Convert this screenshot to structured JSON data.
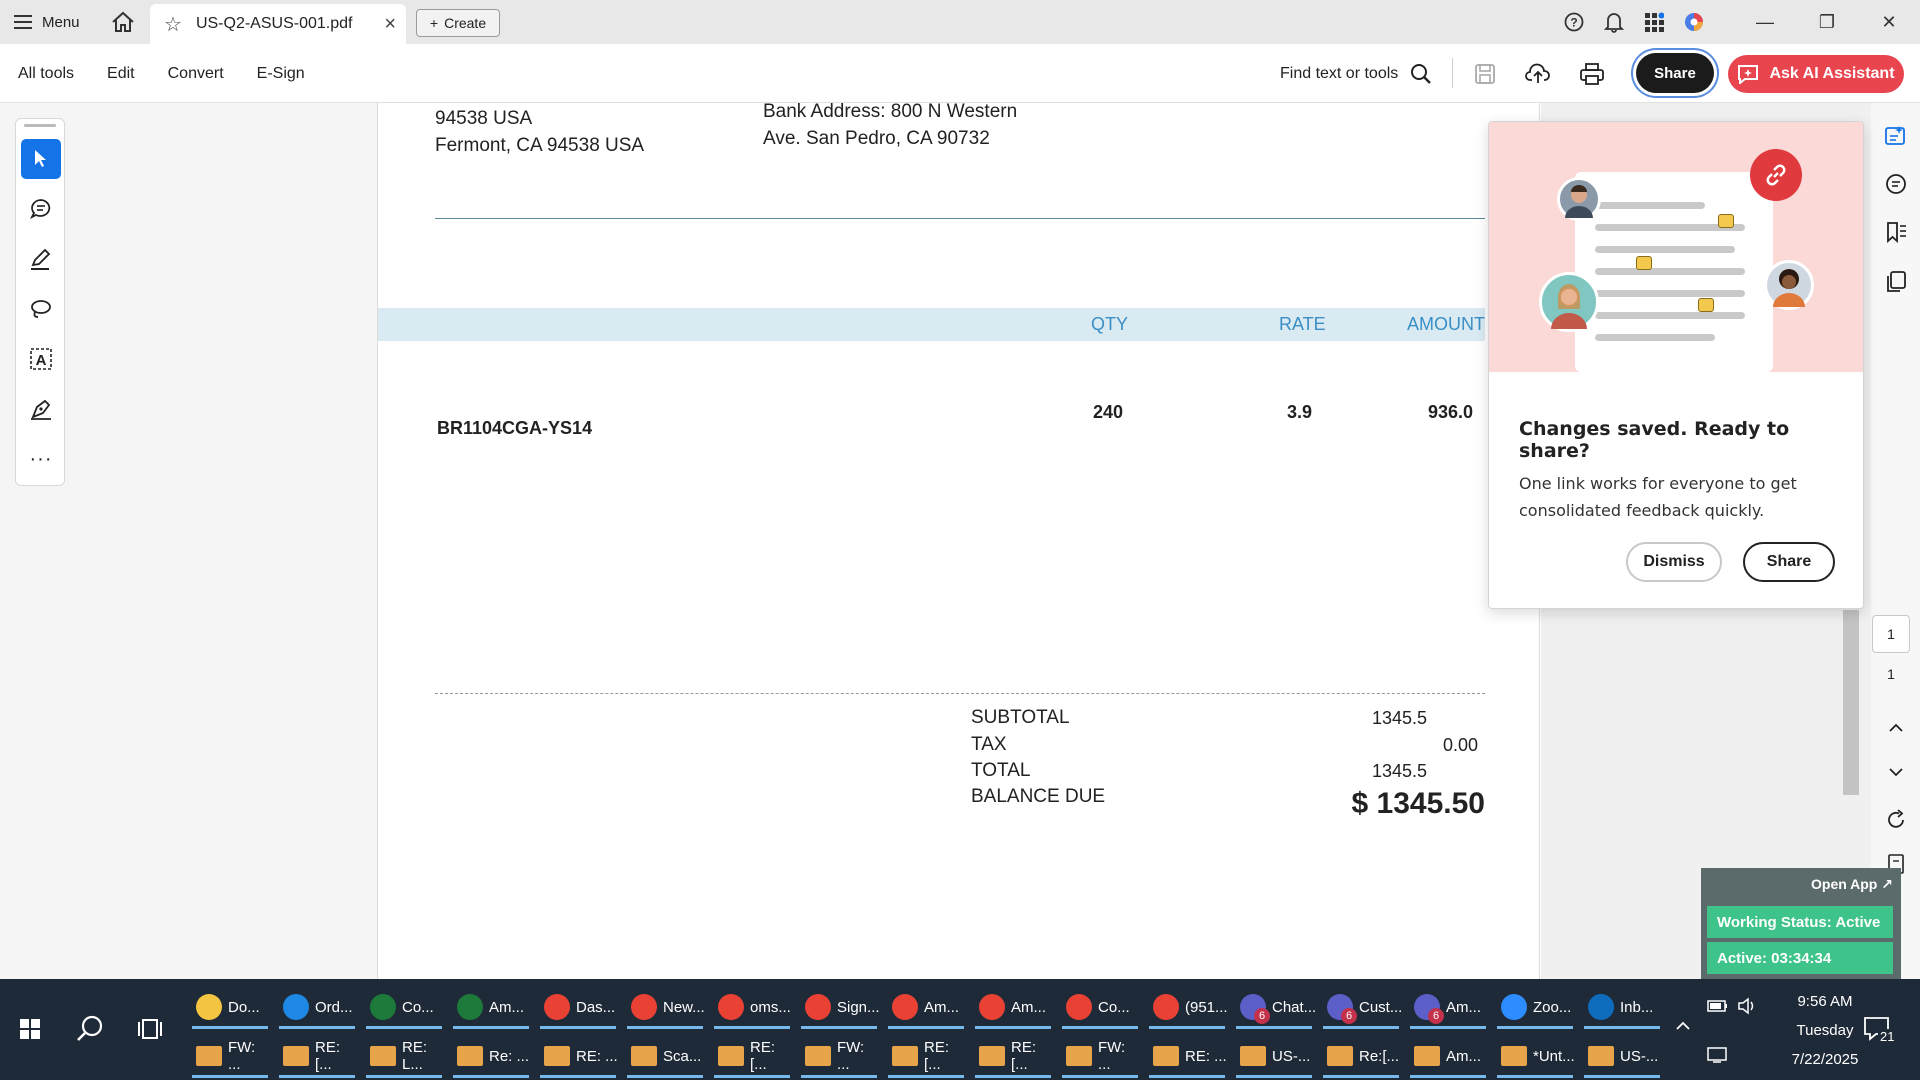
{
  "titlebar": {
    "menu_label": "Menu",
    "tab_title": "US-Q2-ASUS-001.pdf",
    "create_label": "Create"
  },
  "toolbar": {
    "menu": [
      "All tools",
      "Edit",
      "Convert",
      "E-Sign"
    ],
    "find_label": "Find text or tools",
    "share_label": "Share",
    "ask_ai_label": "Ask AI Assistant"
  },
  "document": {
    "addr_left_1": "94538 USA",
    "addr_left_2": "Fermont, CA  94538 USA",
    "bank_1": "Bank Address: 800 N Western",
    "bank_2": "Ave. San Pedro, CA 90732",
    "headers": {
      "qty": "QTY",
      "rate": "RATE",
      "amount": "AMOUNT"
    },
    "item": {
      "name": "BR1104CGA-YS14",
      "qty": "240",
      "rate": "3.9",
      "amount": "936.0"
    },
    "summary": {
      "subtotal_label": "SUBTOTAL",
      "subtotal": "1345.5",
      "tax_label": "TAX",
      "tax": "0.00",
      "total_label": "TOTAL",
      "total": "1345.5",
      "balance_label": "BALANCE DUE",
      "balance": "$  1345.50"
    }
  },
  "popup": {
    "title": "Changes saved. Ready to share?",
    "body": "One link works for everyone to get consolidated feedback quickly.",
    "dismiss": "Dismiss",
    "share": "Share"
  },
  "pager": {
    "current": "1",
    "total": "1"
  },
  "status_widget": {
    "open_app": "Open App ↗",
    "working_status": "Working Status: Active",
    "active_time": "Active: 03:34:34"
  },
  "taskbar": {
    "row1": [
      {
        "label": "Do...",
        "color": "#f4c542"
      },
      {
        "label": "Ord...",
        "color": "#1e88e5"
      },
      {
        "label": "Co...",
        "color": "#1d7a3a"
      },
      {
        "label": "Am...",
        "color": "#1d7a3a"
      },
      {
        "label": "Das...",
        "color": "#e94235"
      },
      {
        "label": "New...",
        "color": "#e94235"
      },
      {
        "label": "oms...",
        "color": "#e94235"
      },
      {
        "label": "Sign...",
        "color": "#e94235"
      },
      {
        "label": "Am...",
        "color": "#e94235"
      },
      {
        "label": "Am...",
        "color": "#e94235"
      },
      {
        "label": "Co...",
        "color": "#e94235"
      },
      {
        "label": "(951...",
        "color": "#e94235"
      },
      {
        "label": "Chat...",
        "color": "#5b5fc7",
        "badge": "6"
      },
      {
        "label": "Cust...",
        "color": "#5b5fc7",
        "badge": "6"
      },
      {
        "label": "Am...",
        "color": "#5b5fc7",
        "badge": "6"
      },
      {
        "label": "Zoo...",
        "color": "#2d8cff"
      },
      {
        "label": "Inb...",
        "color": "#0f6cbd"
      }
    ],
    "row2": [
      {
        "label": "FW: ..."
      },
      {
        "label": "RE: [..."
      },
      {
        "label": "RE: L..."
      },
      {
        "label": "Re: ..."
      },
      {
        "label": "RE: ..."
      },
      {
        "label": "Sca..."
      },
      {
        "label": "RE: [..."
      },
      {
        "label": "FW: ..."
      },
      {
        "label": "RE: [..."
      },
      {
        "label": "RE: [..."
      },
      {
        "label": "FW: ..."
      },
      {
        "label": "RE: ..."
      },
      {
        "label": "US-..."
      },
      {
        "label": "Re:[..."
      },
      {
        "label": "Am..."
      },
      {
        "label": "*Unt..."
      },
      {
        "label": "US-..."
      }
    ],
    "time": "9:56 AM",
    "day": "Tuesday",
    "date": "7/22/2025",
    "notif_count": "21"
  }
}
